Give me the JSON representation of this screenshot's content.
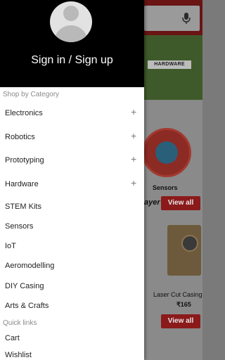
{
  "drawer": {
    "signin_label": "Sign in / Sign up",
    "shop_section_label": "Shop by Category",
    "categories": [
      {
        "label": "Electronics",
        "expand_icon": "+"
      },
      {
        "label": "Robotics",
        "expand_icon": "+"
      },
      {
        "label": "Prototyping",
        "expand_icon": "+"
      },
      {
        "label": "Hardware",
        "expand_icon": "+"
      },
      {
        "label": "STEM Kits"
      },
      {
        "label": "Sensors"
      },
      {
        "label": "IoT"
      },
      {
        "label": "Aeromodelling"
      },
      {
        "label": "DIY Casing"
      },
      {
        "label": "Arts & Crafts"
      }
    ],
    "quick_links_label": "Quick links",
    "quick_links": [
      {
        "label": "Cart"
      },
      {
        "label": "Wishlist"
      }
    ]
  },
  "background": {
    "banner_label": "HARDWARE",
    "sensors_label": "Sensors",
    "section_title_fragment": "ayer",
    "view_all_label": "View all",
    "product_name": "Laser Cut Casing",
    "product_price": "₹165"
  },
  "colors": {
    "drawer_header": "#000000",
    "accent_red": "#8b1a1a",
    "section_label_gray": "#8a8a8a"
  }
}
